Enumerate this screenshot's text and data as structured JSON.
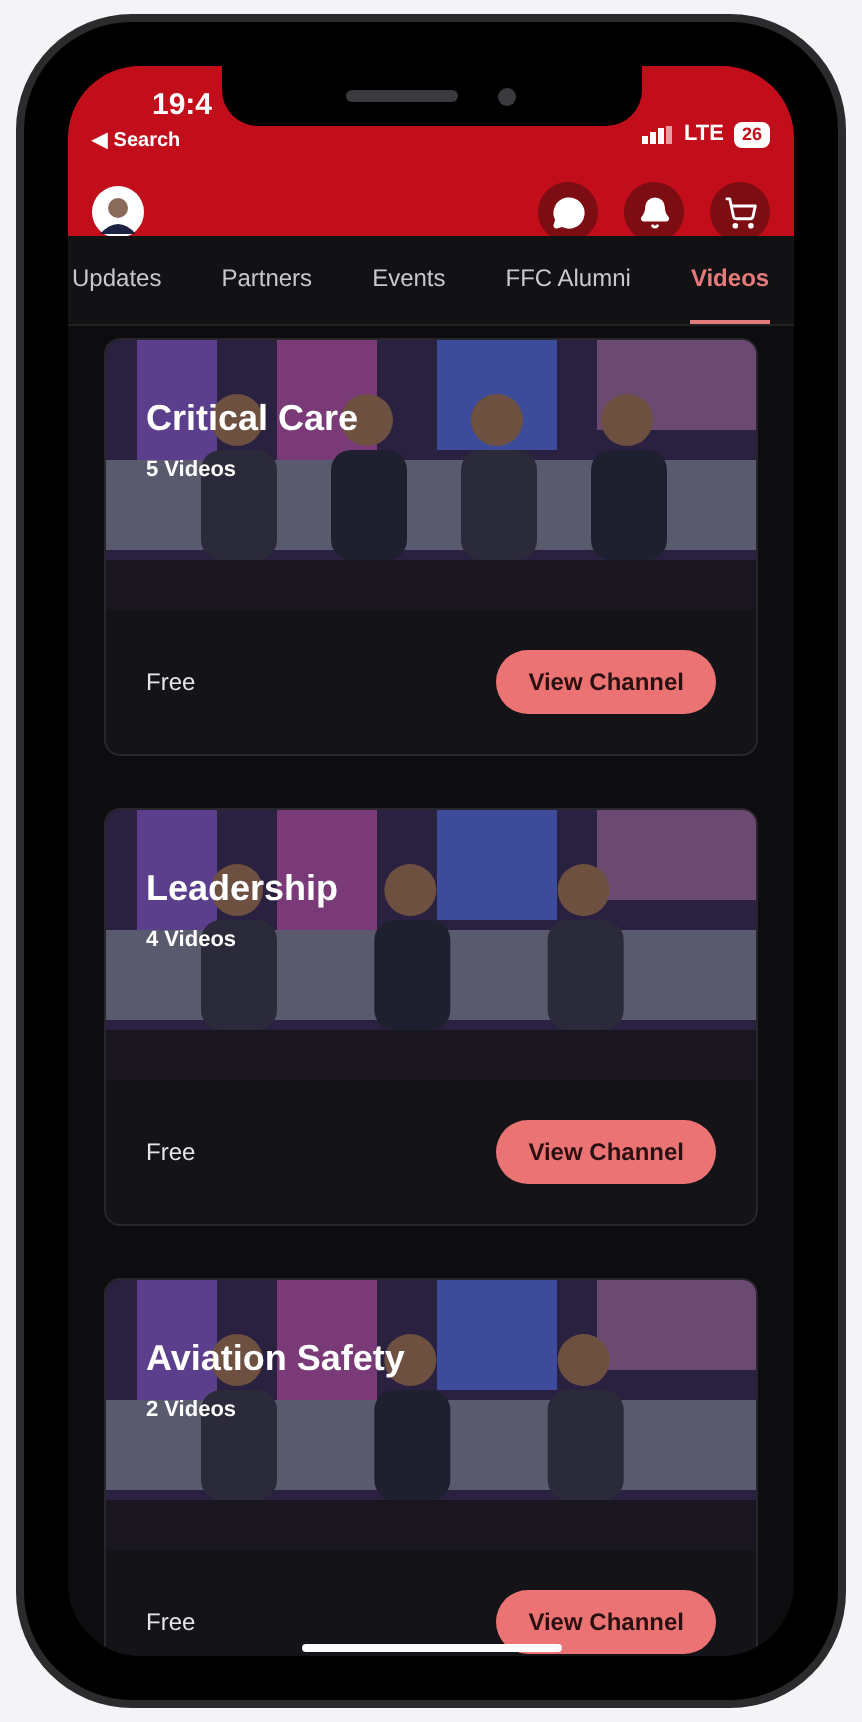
{
  "status_bar": {
    "time": "19:4",
    "back_label": "◀ Search",
    "network": "LTE",
    "battery": "26"
  },
  "tabs": [
    {
      "label": "Updates",
      "selected": false
    },
    {
      "label": "Partners",
      "selected": false
    },
    {
      "label": "Events",
      "selected": false
    },
    {
      "label": "FFC Alumni",
      "selected": false
    },
    {
      "label": "Videos",
      "selected": true
    }
  ],
  "channels": [
    {
      "title": "Critical Care",
      "count": "5 Videos",
      "price": "Free",
      "action": "View Channel"
    },
    {
      "title": "Leadership",
      "count": "4 Videos",
      "price": "Free",
      "action": "View Channel"
    },
    {
      "title": "Aviation Safety",
      "count": "2 Videos",
      "price": "Free",
      "action": "View Channel"
    }
  ]
}
